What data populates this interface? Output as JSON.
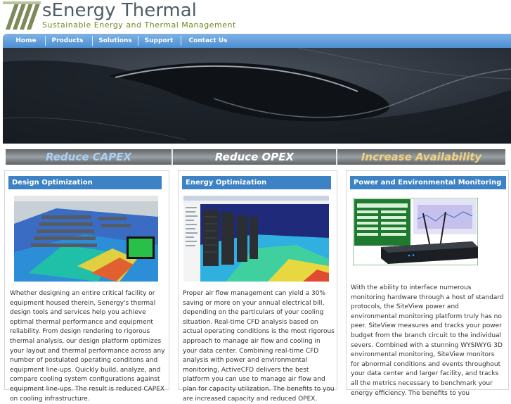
{
  "brand": {
    "name": "sEnergy Thermal",
    "tagline": "Sustainable Energy and Thermal Management"
  },
  "nav": {
    "items": [
      "Home",
      "Products",
      "Solutions",
      "Support",
      "Contact Us"
    ]
  },
  "value_strip": {
    "items": [
      {
        "label": "Reduce CAPEX",
        "color": "#a9cff5"
      },
      {
        "label": "Reduce OPEX",
        "color": "#ffffff"
      },
      {
        "label": "Increase Availability",
        "color": "#f4d27c"
      }
    ]
  },
  "columns": [
    {
      "heading": "Design Optimization",
      "text": "Whether designing an entire critical facility or equipment housed therein, Senergy's thermal design tools and services help you achieve optimal thermal performance and equipment reliability. From design rendering to rigorous thermal analysis, our design platform optimizes your layout and thermal performance across any number of postulated operating conditons and equipment line-ups. Quickly build, analyze, and compare cooling system configurations against equipment line-ups. The result is reduced CAPEX on cooling infrastructure."
    },
    {
      "heading": "Energy Optimization",
      "text": "Proper air flow management can yield a 30% saving or more on your annual electrical bill, depending on the particulars of your cooling situation. Real-time CFD analysis based on actual operating conditions is the most rigorous approach to manage air flow and cooling in your data center. Combining real-time CFD analysis with power and environmental monitoring, ActiveCFD delivers the best platform you can use to manage air flow and plan for capacity utilization. The benefits to you are increased capacity and reduced OPEX."
    },
    {
      "heading": "Power and Environmental Monitoring",
      "text": "With the ability to interface numerous monitoring hardware through a host of standard protocols, the SiteView power and environmental monitoring platform truly has no peer. SiteView measures and tracks your power budget from the branch circuit to the individual severs. Combined with a stunning WYSIWYG 3D environmental monitoring, SiteView monitors for abnormal conditions and events throughout your data center and larger facility, and tracks all the metrics necessary to benchmark your energy efficiency. The benefits to you"
    }
  ],
  "colors": {
    "nav": "#4b8fd2",
    "heading": "#3d82c4",
    "brand_text": "#4f5d66",
    "tagline": "#6d8a1c"
  }
}
